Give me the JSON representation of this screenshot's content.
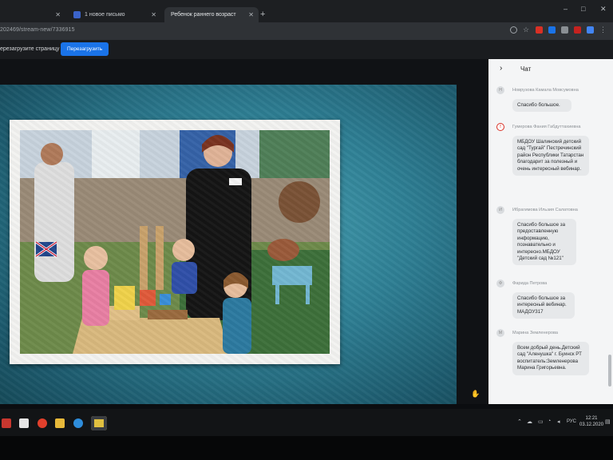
{
  "browser": {
    "tabs": [
      {
        "label": "",
        "active": false
      },
      {
        "label": "1 новое письмо",
        "active": false
      },
      {
        "label": "Ребенок раннего возраст",
        "active": true
      }
    ],
    "new_tab_glyph": "+",
    "url": "202469/stream-new/7336915",
    "win_controls": {
      "minimize": "–",
      "maximize": "□",
      "close": "✕"
    }
  },
  "infobar": {
    "text": "ерезагрузите страницу",
    "reload_label": "Перезагрузить"
  },
  "chat": {
    "title": "Чат",
    "messages": [
      {
        "sender": "Новрузова Камала Мовсумовна",
        "text": "Спасибо большое.",
        "alert": false
      },
      {
        "sender": "Гумерова Фания Габдуттахиевна",
        "text": "МБДОУ Шалинский детский сад \"Тургай\" Пестречинский район Республики Татарстан благодарит за полезный и очень интересный вебинар.",
        "alert": true
      },
      {
        "sender": "Ибрагимова Ильзия Салатовна",
        "text": "Спасибо большое за предоставленную информацию, познавательно и интересно.МБДОУ \"Детский сад №121\"",
        "alert": false
      },
      {
        "sender": "Фарида Петрова",
        "text": "Спасибо большое за интересный вебинар. МАДОУ317",
        "alert": false
      },
      {
        "sender": "Марина Земленерова",
        "text": "Всем добрый день.Детский сад \"Аленушка\" г. Буинск РТ воспитатель:Земленерова Марина Григорьевна.",
        "alert": false
      }
    ]
  },
  "taskbar": {
    "lang": "РУС",
    "time": "12:21",
    "date": "03.12.2020"
  },
  "colors": {
    "accent": "#1a73e8",
    "alert": "#d93025",
    "slide_teal": "#2e7f94"
  }
}
